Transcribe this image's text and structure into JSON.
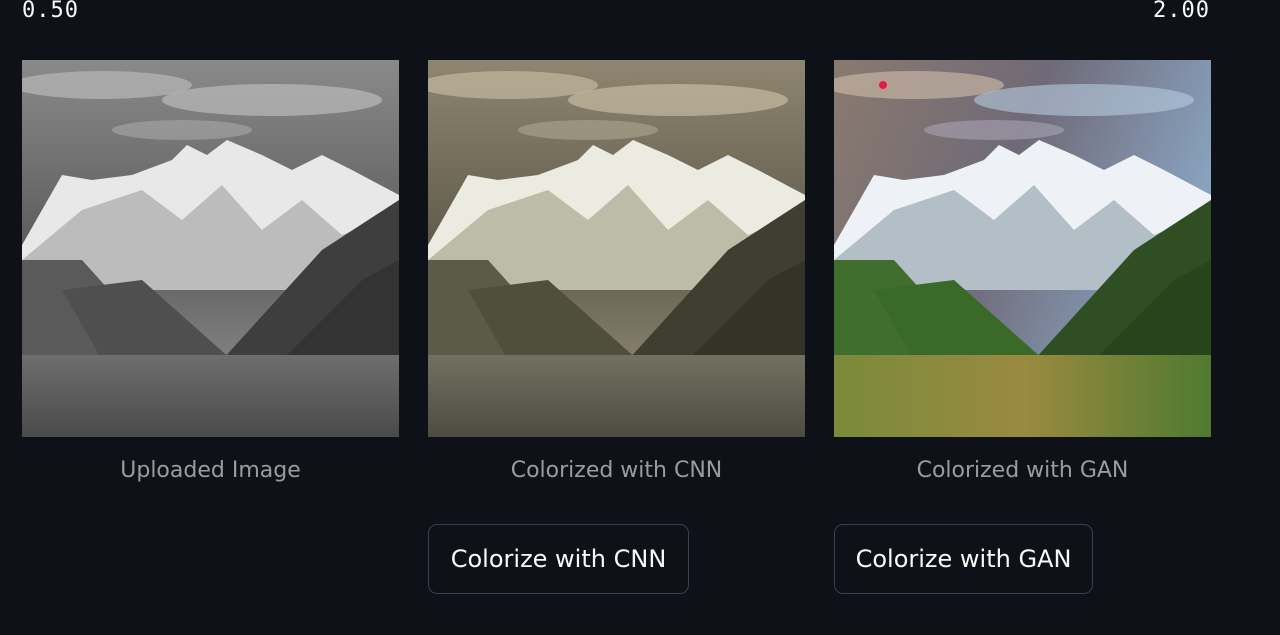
{
  "slider": {
    "min_label": "0.50",
    "max_label": "2.00"
  },
  "images": {
    "uploaded_caption": "Uploaded Image",
    "cnn_caption": "Colorized with CNN",
    "gan_caption": "Colorized with GAN"
  },
  "buttons": {
    "cnn_label": "Colorize with CNN",
    "gan_label": "Colorize with GAN"
  },
  "colors": {
    "background": "#0e1117",
    "button_border": "#3b3f4a",
    "caption_text": "#9a9ca3",
    "marker_dot": "#e8194a"
  }
}
